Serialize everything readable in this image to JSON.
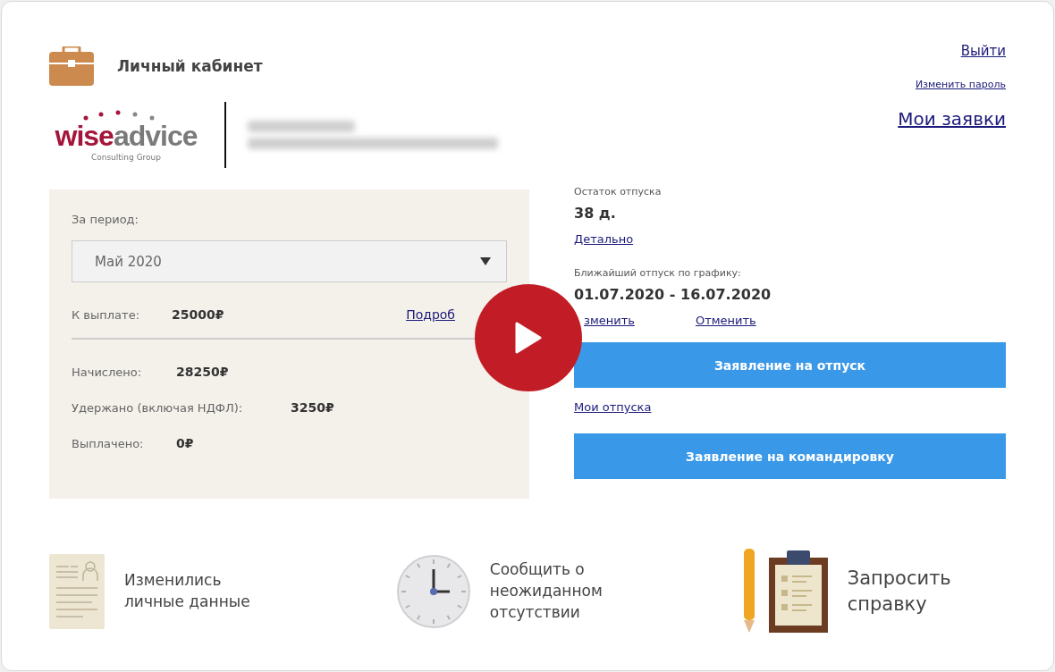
{
  "header": {
    "title": "Личный кабинет",
    "logo": {
      "brand_left": "wise",
      "brand_right": "advice",
      "tagline": "Consulting Group"
    },
    "links": [
      {
        "label": "Выйти",
        "kind": "medium"
      },
      {
        "label": "Изменить пароль",
        "kind": "small"
      },
      {
        "label": "Мои заявки",
        "kind": "large"
      }
    ]
  },
  "salary": {
    "period_label": "За период:",
    "period_value": "Май 2020",
    "payout_label": "К выплате:",
    "payout_value": "25000₽",
    "details_link": "Подроб",
    "rows": [
      {
        "label": "Начислено:",
        "value": "28250₽"
      },
      {
        "label": "Удержано (включая НДФЛ):",
        "value": "3250₽"
      },
      {
        "label": "Выплачено:",
        "value": "0₽"
      }
    ]
  },
  "vacation": {
    "balance_label": "Остаток отпуска",
    "balance_value": "38 д.",
    "details_link": "Детально",
    "next_label": "Ближайший отпуск по графику:",
    "next_value": "01.07.2020 - 16.07.2020",
    "change_link": "зменить",
    "cancel_link": "Отменить",
    "vacation_button": "Заявление на отпуск",
    "my_vacations_link": "Мои отпуска",
    "trip_button": "Заявление на командировку"
  },
  "actions": [
    {
      "kind": "document",
      "label": "Изменились личные данные"
    },
    {
      "kind": "clock",
      "label": "Сообщить о неожиданном отсутствии"
    },
    {
      "kind": "clipboard",
      "label": "Запросить справку"
    }
  ]
}
